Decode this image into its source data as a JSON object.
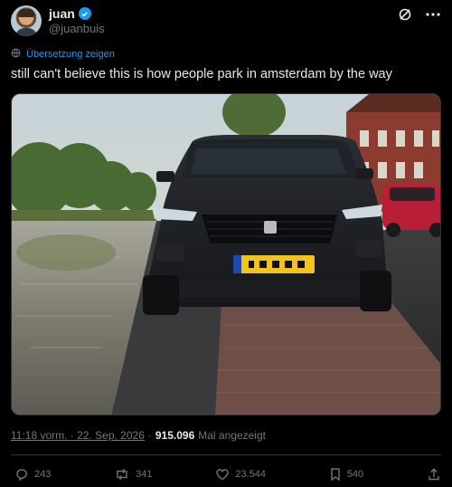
{
  "user": {
    "display_name": "juan",
    "handle": "@juanbuis"
  },
  "translate_label": "Übersetzung zeigen",
  "tweet_text": "still can't believe this is how people park in amsterdam by the way",
  "meta": {
    "time": "11:18 vorm. · 22. Sep. 2026",
    "separator": "·",
    "views_count": "915.096",
    "views_label": "Mal angezeigt"
  },
  "actions": {
    "replies": "243",
    "reposts": "341",
    "likes": "23.544",
    "bookmarks": "540"
  },
  "icons": {
    "verified": "verified-badge-icon",
    "grok": "grok-icon",
    "more": "more-dots-icon",
    "translate": "globe-translate-icon",
    "reply": "reply-icon",
    "repost": "repost-icon",
    "like": "heart-icon",
    "bookmark": "bookmark-icon",
    "share": "share-icon"
  },
  "colors": {
    "background": "#000000",
    "text": "#e7e9ea",
    "muted": "#71767b",
    "accent": "#1d9bf0"
  }
}
